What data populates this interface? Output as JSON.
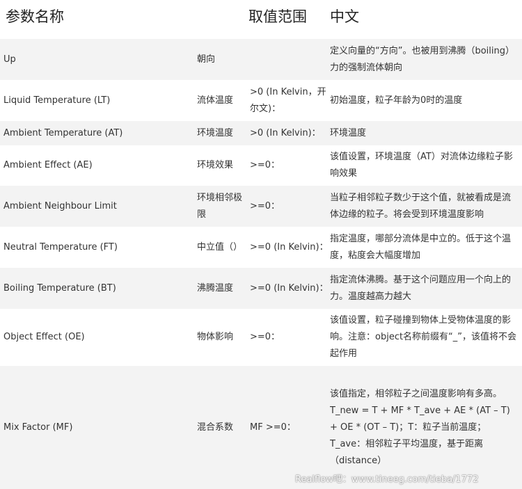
{
  "headers": {
    "name": "参数名称",
    "range": "取值范围",
    "cn": "中文"
  },
  "rows": [
    {
      "name": "Up",
      "cn": "朝向",
      "range": "",
      "desc": "定义向量的“方向”。也被用到沸腾（boiling）力的强制流体朝向"
    },
    {
      "name": "Liquid Temperature (LT)",
      "cn": "流体温度",
      "range": ">0 (In Kelvin，开尔文)：",
      "desc": "初始温度，粒子年龄为0时的温度"
    },
    {
      "name": "Ambient Temperature (AT)",
      "cn": "环境温度",
      "range": ">0 (In Kelvin)：",
      "desc": "环境温度"
    },
    {
      "name": "Ambient Effect (AE)",
      "cn": "环境效果",
      "range": ">=0：",
      "desc": "该值设置，环境温度（AT）对流体边缘粒子影响效果"
    },
    {
      "name": "Ambient Neighbour Limit",
      "cn": "环境相邻极限",
      "range": ">=0：",
      "desc": "当粒子相邻粒子数少于这个值，就被看成是流体边缘的粒子。将会受到环境温度影响"
    },
    {
      "name": "Neutral Temperature (FT)",
      "cn": "中立值（）",
      "range": ">=0 (In Kelvin)：",
      "desc": "指定温度，哪部分流体是中立的。低于这个温度，粘度会大幅度增加"
    },
    {
      "name": "Boiling Temperature (BT)",
      "cn": "沸腾温度",
      "range": ">=0 (In Kelvin)：",
      "desc": "指定流体沸腾。基于这个问题应用一个向上的力。温度越高力越大"
    },
    {
      "name": "Object Effect (OE)",
      "cn": "物体影响",
      "range": ">=0：",
      "desc": "该值设置，粒子碰撞到物体上受物体温度的影响。注意：object名称前缀有“_”，该值将不会起作用"
    },
    {
      "name": "Mix Factor (MF)",
      "cn": "混合系数",
      "range": "MF >=0：",
      "desc": "该值指定，相邻粒子之间温度影响有多高。T_new = T + MF * T_ave + AE * (AT – T) + OE * (OT – T)；T：粒子当前温度；T_ave：相邻粒子平均温度，基于距离（distance）"
    }
  ],
  "watermark": "Realflow吧：www.tineeg.com/tieba/1772"
}
